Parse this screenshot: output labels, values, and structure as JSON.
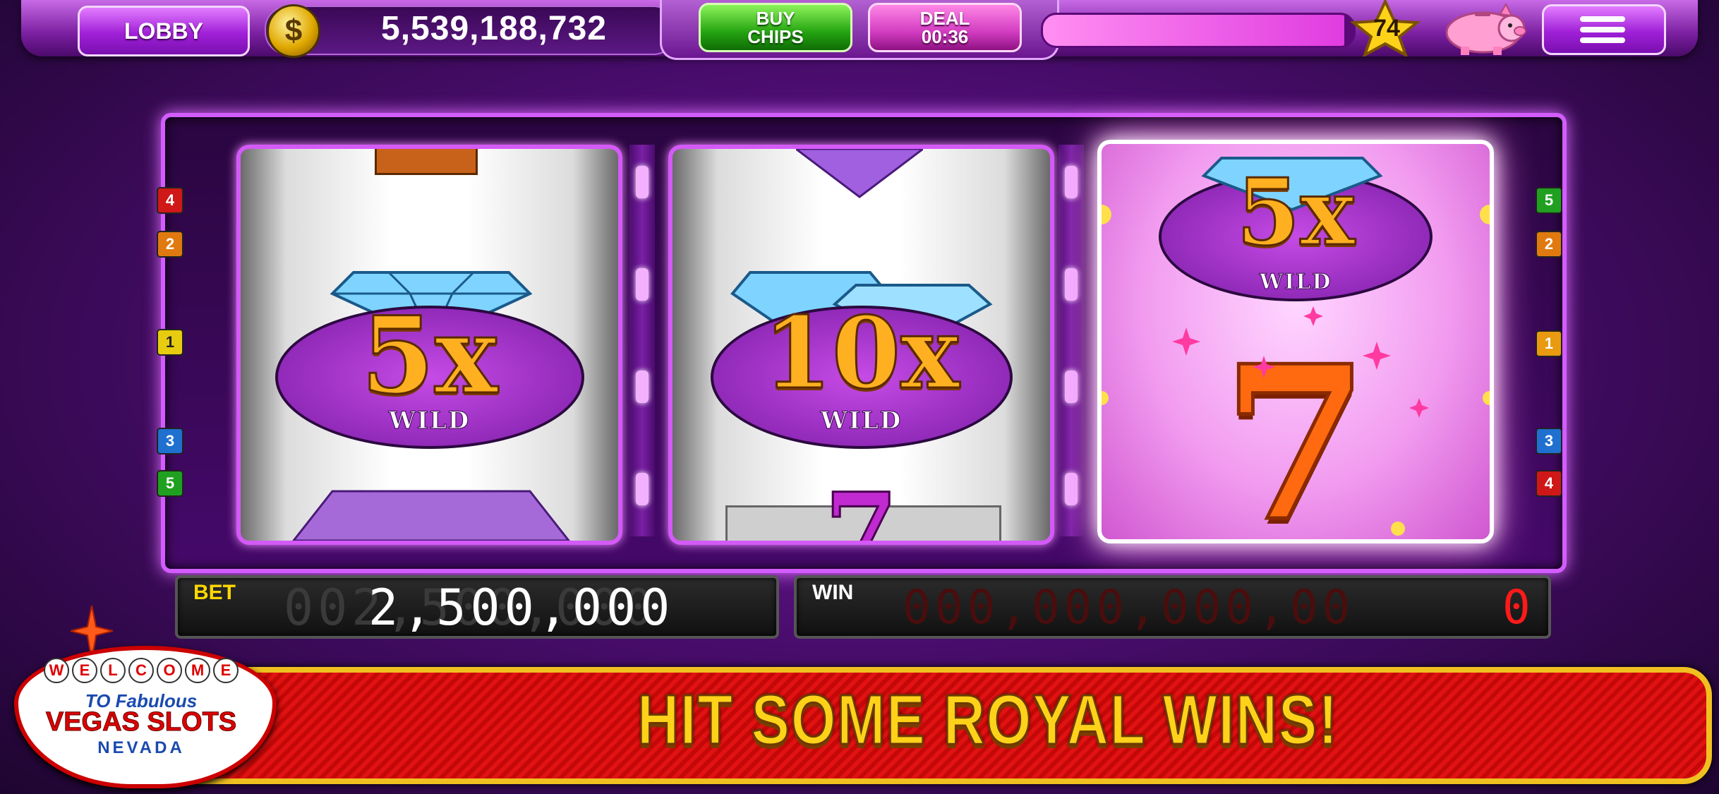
{
  "header": {
    "lobby_label": "LOBBY",
    "coin_symbol": "$",
    "balance": "5,539,188,732",
    "buy_line1": "BUY",
    "buy_line2": "CHIPS",
    "deal_line1": "DEAL",
    "deal_timer": "00:36",
    "level": "74",
    "xp_progress": 0.97
  },
  "reels": {
    "reel1_mult": "5x",
    "reel1_wild": "WILD",
    "reel2_mult": "10x",
    "reel2_wild": "WILD",
    "reel2_bottom": "7",
    "reel3_mult": "5x",
    "reel3_wild": "WILD",
    "reel3_seven": "7"
  },
  "paylines": {
    "left": [
      "4",
      "2",
      "1",
      "3",
      "5"
    ],
    "right": [
      "5",
      "2",
      "1",
      "3",
      "4"
    ]
  },
  "meters": {
    "bet_label": "BET",
    "bet_ghost": "002,500,000",
    "bet_value": "2,500,000",
    "win_label": "WIN",
    "win_ghost": "000,000,000,00",
    "win_value": "0"
  },
  "banner": {
    "text": "HIT SOME ROYAL WINS!"
  },
  "logo": {
    "welcome": "WELCOME",
    "to_fabulous": "TO Fabulous",
    "title": "VEGAS SLOTS",
    "state": "NEVADA"
  },
  "colors": {
    "accent": "#c040e8",
    "buy_green": "#25a412",
    "deal_pink": "#d23cc0",
    "banner_red": "#d10d0d",
    "banner_text": "#ffd21a",
    "win_red": "#ff1a1a"
  }
}
